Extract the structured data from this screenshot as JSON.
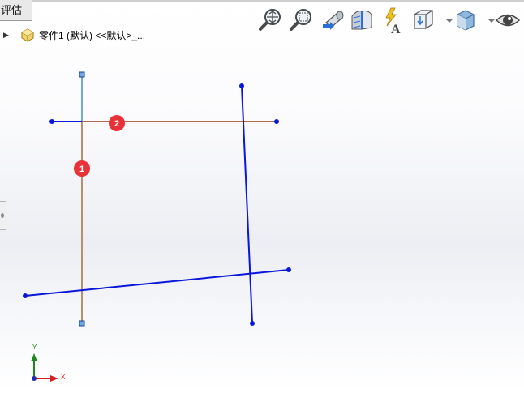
{
  "tab": {
    "label": "评估"
  },
  "feature_tree": {
    "part_label": "零件1 (默认) <<默认>_..."
  },
  "toolbar": {
    "tools": [
      "zoom-to-fit-icon",
      "zoom-to-area-icon",
      "previous-view-icon",
      "section-view-icon",
      "dynamic-annotation-icon",
      "view-orientation-icon",
      "display-style-icon",
      "hide-show-icon"
    ]
  },
  "sketch": {
    "badges": [
      "1",
      "2"
    ],
    "colors": {
      "line": "#0a16d8",
      "selected": "#6da8e0",
      "highlight": "#b46a4e",
      "badge": "#e8323a"
    }
  },
  "triad": {
    "x_label": "X",
    "y_label": "Y"
  }
}
